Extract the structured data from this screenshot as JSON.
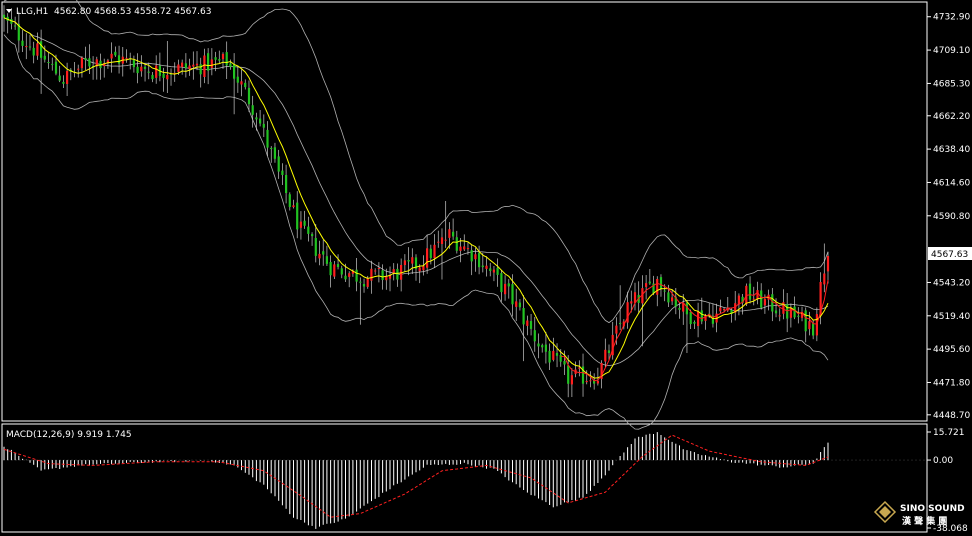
{
  "main_header": {
    "symbol_tf": "LLG,H1",
    "ohlc": "4562.80 4568.53 4558.72 4567.63"
  },
  "sub_header": {
    "label": "MACD(12,26,9) 9.919 1.745"
  },
  "price_axis": {
    "ticks": [
      "4732.90",
      "4709.10",
      "4685.30",
      "4662.20",
      "4638.40",
      "4614.60",
      "4590.80",
      "4543.20",
      "4519.40",
      "4495.60",
      "4471.80",
      "4448.70"
    ],
    "current": "4567.63"
  },
  "macd_axis": {
    "top": "15.721",
    "zero": "0.00",
    "bottom": "-38.068"
  },
  "watermark": {
    "brand": "SINO SOUND",
    "chinese": "漢 聲 集 團"
  },
  "colors": {
    "bull": "#ff1f1f",
    "bear": "#22c322",
    "wick": "#cccccc",
    "ma": "#ffff00",
    "band": "#b0b0b0",
    "signal": "#ff2020",
    "macd": "#ffffff",
    "grid": "#ffffff",
    "background": "#000000"
  },
  "chart_data": {
    "type": "candlestick",
    "timeframe": "H1",
    "price_range": [
      4445,
      4742
    ],
    "macd_range": [
      -38.068,
      15.721
    ],
    "close_path": [
      {
        "i": 0,
        "v": 4730
      },
      {
        "i": 8,
        "v": 4710
      },
      {
        "i": 16,
        "v": 4688
      },
      {
        "i": 22,
        "v": 4700
      },
      {
        "i": 30,
        "v": 4704
      },
      {
        "i": 40,
        "v": 4694
      },
      {
        "i": 50,
        "v": 4697
      },
      {
        "i": 60,
        "v": 4701
      },
      {
        "i": 64,
        "v": 4684
      },
      {
        "i": 68,
        "v": 4664
      },
      {
        "i": 74,
        "v": 4620
      },
      {
        "i": 80,
        "v": 4580
      },
      {
        "i": 88,
        "v": 4555
      },
      {
        "i": 96,
        "v": 4547
      },
      {
        "i": 104,
        "v": 4548
      },
      {
        "i": 112,
        "v": 4557
      },
      {
        "i": 120,
        "v": 4577
      },
      {
        "i": 128,
        "v": 4560
      },
      {
        "i": 136,
        "v": 4535
      },
      {
        "i": 144,
        "v": 4500
      },
      {
        "i": 152,
        "v": 4475
      },
      {
        "i": 160,
        "v": 4477
      },
      {
        "i": 168,
        "v": 4525
      },
      {
        "i": 176,
        "v": 4545
      },
      {
        "i": 184,
        "v": 4520
      },
      {
        "i": 192,
        "v": 4520
      },
      {
        "i": 200,
        "v": 4535
      },
      {
        "i": 210,
        "v": 4523
      },
      {
        "i": 218,
        "v": 4512
      },
      {
        "i": 222,
        "v": 4568
      }
    ],
    "macd_path": [
      {
        "i": 0,
        "v": 8
      },
      {
        "i": 10,
        "v": -6
      },
      {
        "i": 20,
        "v": -3
      },
      {
        "i": 30,
        "v": -2
      },
      {
        "i": 40,
        "v": -1
      },
      {
        "i": 55,
        "v": 0
      },
      {
        "i": 62,
        "v": -3
      },
      {
        "i": 70,
        "v": -14
      },
      {
        "i": 78,
        "v": -32
      },
      {
        "i": 84,
        "v": -38
      },
      {
        "i": 92,
        "v": -33
      },
      {
        "i": 104,
        "v": -16
      },
      {
        "i": 114,
        "v": -3
      },
      {
        "i": 124,
        "v": -2
      },
      {
        "i": 132,
        "v": -5
      },
      {
        "i": 140,
        "v": -17
      },
      {
        "i": 148,
        "v": -26
      },
      {
        "i": 156,
        "v": -21
      },
      {
        "i": 162,
        "v": -8
      },
      {
        "i": 170,
        "v": 12
      },
      {
        "i": 176,
        "v": 15.7
      },
      {
        "i": 184,
        "v": 5
      },
      {
        "i": 196,
        "v": -1
      },
      {
        "i": 210,
        "v": -4
      },
      {
        "i": 218,
        "v": -2
      },
      {
        "i": 222,
        "v": 9.9
      }
    ],
    "signal_path": [
      {
        "i": 0,
        "v": 6
      },
      {
        "i": 12,
        "v": -2
      },
      {
        "i": 24,
        "v": -3
      },
      {
        "i": 40,
        "v": -1
      },
      {
        "i": 58,
        "v": -1
      },
      {
        "i": 70,
        "v": -6
      },
      {
        "i": 80,
        "v": -20
      },
      {
        "i": 88,
        "v": -32
      },
      {
        "i": 96,
        "v": -30
      },
      {
        "i": 108,
        "v": -19
      },
      {
        "i": 118,
        "v": -6
      },
      {
        "i": 130,
        "v": -3
      },
      {
        "i": 142,
        "v": -10
      },
      {
        "i": 152,
        "v": -24
      },
      {
        "i": 162,
        "v": -18
      },
      {
        "i": 172,
        "v": 2
      },
      {
        "i": 180,
        "v": 14
      },
      {
        "i": 190,
        "v": 5
      },
      {
        "i": 204,
        "v": -1
      },
      {
        "i": 216,
        "v": -3
      },
      {
        "i": 222,
        "v": 1.7
      }
    ],
    "candle_count": 223,
    "x_span": [
      4,
      828
    ]
  }
}
